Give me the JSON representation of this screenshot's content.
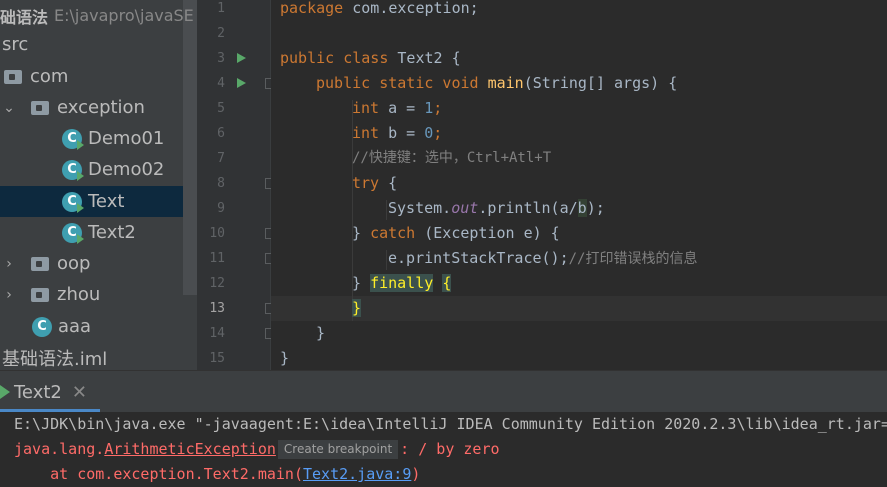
{
  "project_tree": {
    "header_bold": "础语法",
    "header_path": "E:\\javapro\\javaSE",
    "items": [
      {
        "label": "src"
      },
      {
        "label": "com"
      },
      {
        "label": "exception"
      },
      {
        "label": "Demo01"
      },
      {
        "label": "Demo02"
      },
      {
        "label": "Text"
      },
      {
        "label": "Text2"
      },
      {
        "label": "oop"
      },
      {
        "label": "zhou"
      },
      {
        "label": "aaa"
      },
      {
        "label": "基础语法.iml"
      }
    ],
    "class_icon_letter": "C"
  },
  "editor": {
    "line_numbers": [
      "1",
      "2",
      "3",
      "4",
      "5",
      "6",
      "7",
      "8",
      "9",
      "10",
      "11",
      "12",
      "13",
      "14",
      "15"
    ],
    "current_line": "13",
    "code": {
      "l1_kw": "package",
      "l1_rest": " com.exception;",
      "l3_kw": "public class",
      "l3_rest": " Text2 {",
      "l4_kw": "public static void",
      "l4_fn": "main",
      "l4_rest": "(String[] args) {",
      "l5_kw": "int",
      "l5_a": " a = ",
      "l5_num": "1",
      "l5_end": ";",
      "l6_kw": "int",
      "l6_b": " b = ",
      "l6_num": "0",
      "l6_end": ";",
      "l7_comment": "//快捷键：选中，Ctrl+Atl+T",
      "l8_kw": "try",
      "l8_rest": " {",
      "l9_a": "System.",
      "l9_static": "out",
      "l9_b": ".println(a/",
      "l9_var": "b",
      "l9_c": ");",
      "l10_a": "} ",
      "l10_kw": "catch",
      "l10_rest": " (Exception e) {",
      "l11_code": "e.printStackTrace();",
      "l11_comment": "//打印错误栈的信息",
      "l12_a": "} ",
      "l12_kw": "finally",
      "l12_sp": " ",
      "l12_brace": "{",
      "l13_brace": "}",
      "l14_brace": "}",
      "l15_brace": "}"
    }
  },
  "run_panel": {
    "tab_label": "Text2",
    "tab_close": "✕",
    "console": {
      "cmd_line": "E:\\JDK\\bin\\java.exe \"-javaagent:E:\\idea\\IntelliJ IDEA Community Edition 2020.2.3\\lib\\idea_rt.jar=",
      "err_prefix": "java.lang.",
      "err_class": "ArithmeticException",
      "breakpoint_hint": "Create breakpoint",
      "err_suffix": ": / by zero",
      "trace_prefix": "    at com.exception.Text2.main(",
      "trace_link": "Text2.java:9",
      "trace_suffix": ")"
    }
  },
  "colors": {
    "keyword": "#cc7832",
    "number": "#6897bb",
    "comment": "#808080",
    "method": "#ffc66d",
    "static_field": "#9876aa",
    "error": "#ff6b68",
    "link": "#589df6",
    "run_icon": "#59a869"
  }
}
